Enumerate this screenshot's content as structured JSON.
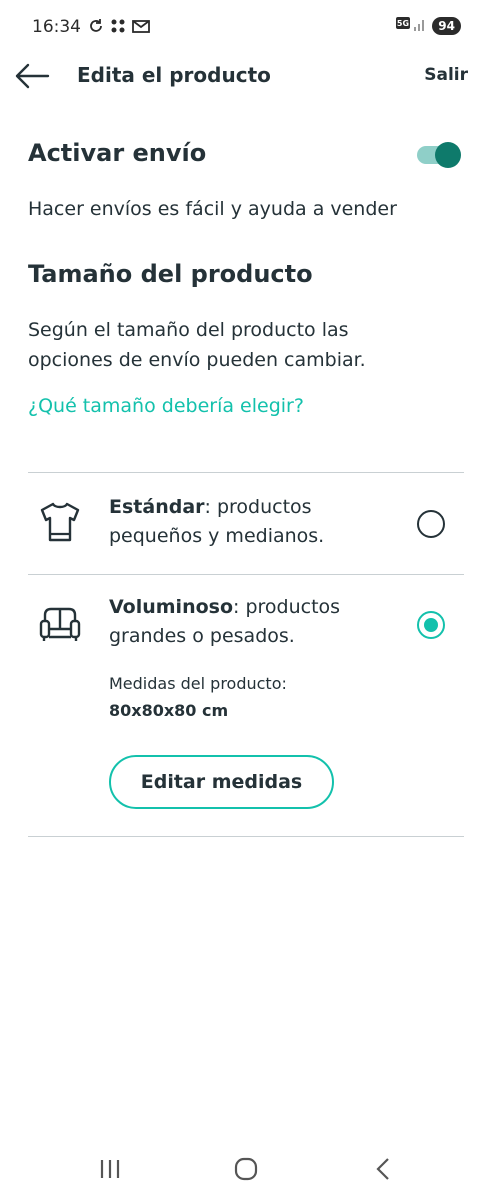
{
  "status_bar": {
    "time": "16:34",
    "network": "5G",
    "battery": "94"
  },
  "app_bar": {
    "title": "Edita el producto",
    "exit_label": "Salir"
  },
  "shipping": {
    "title": "Activar envío",
    "enabled": true,
    "description": "Hacer envíos es fácil y ayuda a vender"
  },
  "size": {
    "title": "Tamaño del producto",
    "description": "Según el tamaño del producto las opciones de envío pueden cambiar.",
    "help_link": "¿Qué tamaño debería elegir?",
    "options": [
      {
        "icon": "t-shirt-icon",
        "name": "Estándar",
        "description": ": productos pequeños y medianos.",
        "selected": false
      },
      {
        "icon": "sofa-icon",
        "name": "Voluminoso",
        "description": ": productos grandes o pesados.",
        "selected": true
      }
    ],
    "measures_label": "Medidas del producto:",
    "measures_value": "80x80x80 cm",
    "edit_button": "Editar medidas"
  },
  "colors": {
    "accent": "#13c1ac",
    "toggle_on": "#0e7a6b",
    "text": "#253238"
  }
}
